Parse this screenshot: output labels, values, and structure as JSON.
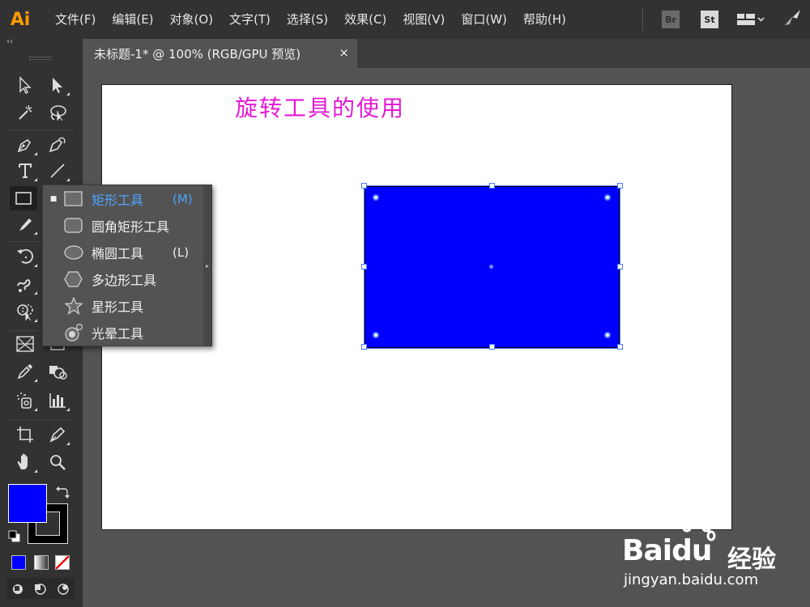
{
  "app": {
    "logo": "Ai"
  },
  "menu": [
    "文件(F)",
    "编辑(E)",
    "对象(O)",
    "文字(T)",
    "选择(S)",
    "效果(C)",
    "视图(V)",
    "窗口(W)",
    "帮助(H)"
  ],
  "menu_right": {
    "bridge": "Br",
    "stock": "St"
  },
  "document": {
    "tab_title": "未标题-1* @ 100% (RGB/GPU 预览)",
    "close": "×"
  },
  "artboard": {
    "title_text": "旋转工具的使用"
  },
  "colors": {
    "fill": "#0000ff",
    "stroke": "#000000",
    "accent": "#4da3ff",
    "title": "#e619d6"
  },
  "flyout": {
    "items": [
      {
        "label": "矩形工具",
        "key": "(M)",
        "icon": "rectangle-icon",
        "selected": true
      },
      {
        "label": "圆角矩形工具",
        "key": "",
        "icon": "rounded-rectangle-icon",
        "selected": false
      },
      {
        "label": "椭圆工具",
        "key": "(L)",
        "icon": "ellipse-icon",
        "selected": false
      },
      {
        "label": "多边形工具",
        "key": "",
        "icon": "polygon-icon",
        "selected": false
      },
      {
        "label": "星形工具",
        "key": "",
        "icon": "star-icon",
        "selected": false
      },
      {
        "label": "光晕工具",
        "key": "",
        "icon": "flare-icon",
        "selected": false
      }
    ]
  },
  "watermark": {
    "logo_a": "Bai",
    "logo_b": "du",
    "cn": "经验",
    "url": "jingyan.baidu.com"
  }
}
